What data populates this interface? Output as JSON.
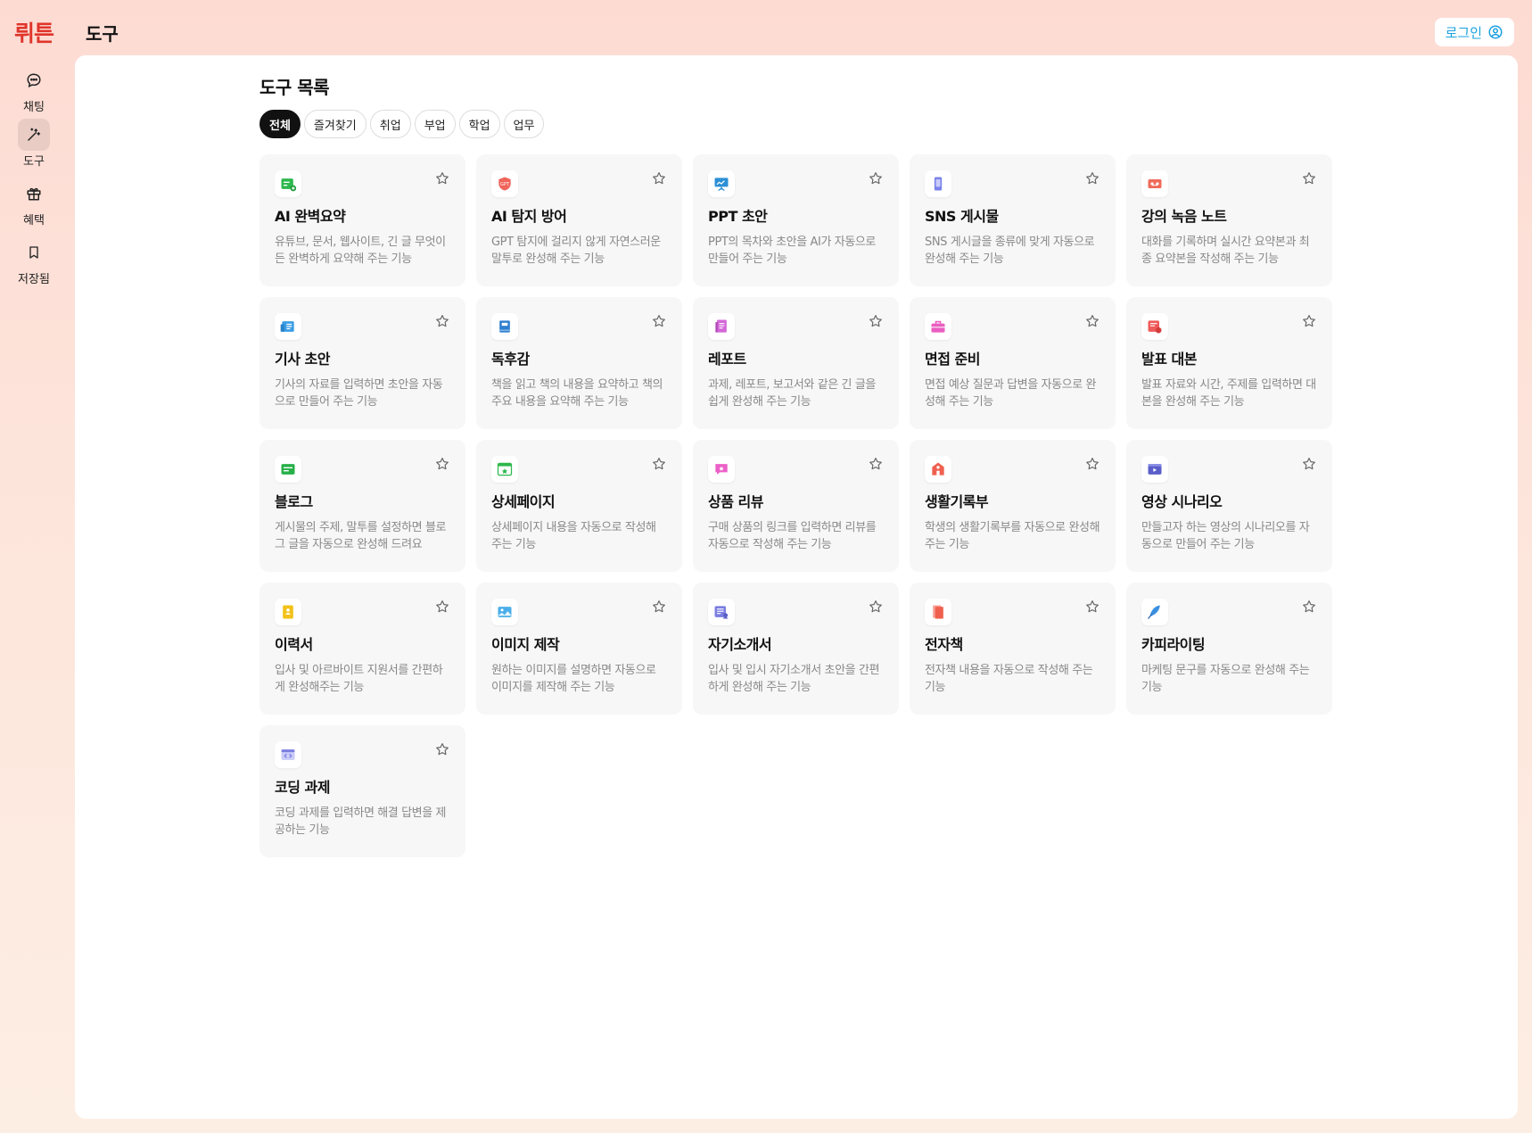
{
  "app": {
    "logo": "뤼튼",
    "page_title": "도구",
    "login_label": "로그인"
  },
  "colors": {
    "brand": "#e0352b",
    "login": "#1ba1e0",
    "card_bg": "#f7f7f7"
  },
  "sidebar": {
    "items": [
      {
        "label": "채팅",
        "icon": "chat-bubble-icon",
        "active": false
      },
      {
        "label": "도구",
        "icon": "magic-wand-icon",
        "active": true
      },
      {
        "label": "혜택",
        "icon": "gift-icon",
        "active": false
      },
      {
        "label": "저장됨",
        "icon": "bookmark-icon",
        "active": false
      }
    ]
  },
  "tools": {
    "section_title": "도구 목록",
    "tabs": [
      {
        "label": "전체",
        "active": true
      },
      {
        "label": "즐겨찾기",
        "active": false
      },
      {
        "label": "취업",
        "active": false
      },
      {
        "label": "부업",
        "active": false
      },
      {
        "label": "학업",
        "active": false
      },
      {
        "label": "업무",
        "active": false
      }
    ],
    "cards": [
      {
        "title": "AI 완벽요약",
        "desc": "유튜브, 문서, 웹사이트, 긴 글 무엇이든 완벽하게 요약해 주는 기능",
        "icon": "summary-icon",
        "color": "#2db84d"
      },
      {
        "title": "AI 탐지 방어",
        "desc": "GPT 탐지에 걸리지 않게 자연스러운 말투로 완성해 주는 기능",
        "icon": "gpt-shield-icon",
        "color": "#f0645a"
      },
      {
        "title": "PPT 초안",
        "desc": "PPT의 목차와 초안을 AI가 자동으로 만들어 주는 기능",
        "icon": "presentation-board-icon",
        "color": "#2b8fd6"
      },
      {
        "title": "SNS 게시물",
        "desc": "SNS 게시글을 종류에 맞게 자동으로 완성해 주는 기능",
        "icon": "smartphone-icon",
        "color": "#7b83ea"
      },
      {
        "title": "강의 녹음 노트",
        "desc": "대화를 기록하며 실시간 요약본과 최종 요약본을 작성해 주는 기능",
        "icon": "cassette-tape-icon",
        "color": "#f06a5a"
      },
      {
        "title": "기사 초안",
        "desc": "기사의 자료를 입력하면 초안을 자동으로 만들어 주는 기능",
        "icon": "newspaper-icon",
        "color": "#3a9ee4"
      },
      {
        "title": "독후감",
        "desc": "책을 읽고 책의 내용을 요약하고 책의 주요 내용을 요약해 주는 기능",
        "icon": "book-icon",
        "color": "#2f7fd0"
      },
      {
        "title": "레포트",
        "desc": "과제, 레포트, 보고서와 같은 긴 글을 쉽게 완성해 주는 기능",
        "icon": "report-document-icon",
        "color": "#d466d8"
      },
      {
        "title": "면접 준비",
        "desc": "면접 예상 질문과 답변을 자동으로 완성해 주는 기능",
        "icon": "briefcase-icon",
        "color": "#e95ec0"
      },
      {
        "title": "발표 대본",
        "desc": "발표 자료와 시간, 주제를 입력하면 대본을 완성해 주는 기능",
        "icon": "script-icon",
        "color": "#f05a5a"
      },
      {
        "title": "블로그",
        "desc": "게시물의 주제, 말투를 설정하면 블로그 글을 자동으로 완성해 드려요",
        "icon": "blog-icon",
        "color": "#27b04a"
      },
      {
        "title": "상세페이지",
        "desc": "상세페이지 내용을 자동으로 작성해 주는 기능",
        "icon": "product-page-icon",
        "color": "#2db84d"
      },
      {
        "title": "상품 리뷰",
        "desc": "구매 상품의 링크를 입력하면 리뷰를 자동으로 작성해 주는 기능",
        "icon": "review-bubble-icon",
        "color": "#ec5fc8"
      },
      {
        "title": "생활기록부",
        "desc": "학생의 생활기록부를 자동으로 완성해 주는 기능",
        "icon": "school-icon",
        "color": "#f06050"
      },
      {
        "title": "영상 시나리오",
        "desc": "만들고자 하는 영상의 시나리오를 자동으로 만들어 주는 기능",
        "icon": "video-play-icon",
        "color": "#5a5ec8"
      },
      {
        "title": "이력서",
        "desc": "입사 및 아르바이트 지원서를 간편하게 완성해주는 기능",
        "icon": "resume-icon",
        "color": "#f2c21a"
      },
      {
        "title": "이미지 제작",
        "desc": "원하는 이미지를 설명하면 자동으로 이미지를 제작해 주는 기능",
        "icon": "image-icon",
        "color": "#4aaeea"
      },
      {
        "title": "자기소개서",
        "desc": "입사 및 입시 자기소개서 초안을 간편하게 완성해 주는 기능",
        "icon": "self-intro-icon",
        "color": "#7b7fe0"
      },
      {
        "title": "전자책",
        "desc": "전자책 내용을 자동으로 작성해 주는 기능",
        "icon": "ebook-icon",
        "color": "#f0604e"
      },
      {
        "title": "카피라이팅",
        "desc": "마케팅 문구를 자동으로 완성해 주는 기능",
        "icon": "quill-pen-icon",
        "color": "#3a8ee0"
      },
      {
        "title": "코딩 과제",
        "desc": "코딩 과제를 입력하면 해결 답변을 제공하는 기능",
        "icon": "code-window-icon",
        "color": "#7b7fe0"
      }
    ]
  }
}
